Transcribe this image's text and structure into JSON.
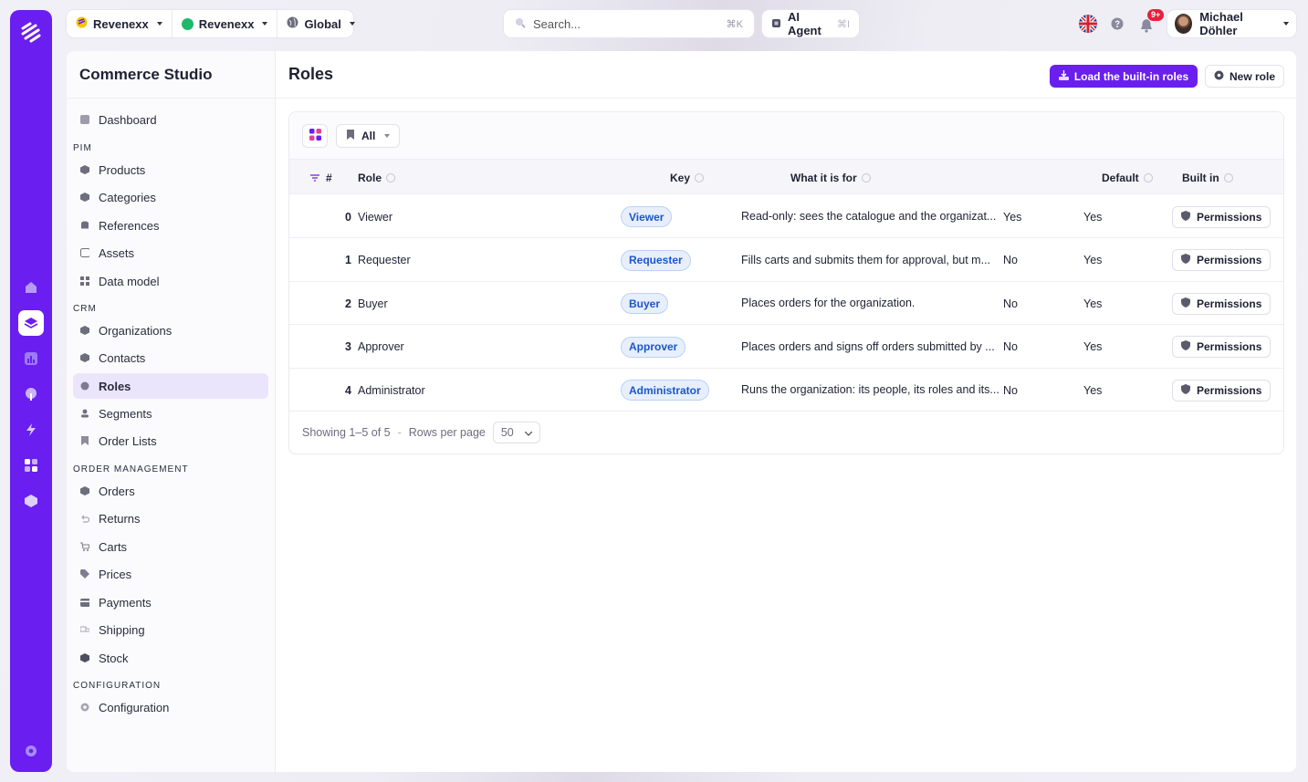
{
  "colors": {
    "accent": "#6a1ef0",
    "key_tag": "#1c56c9"
  },
  "topbar": {
    "workspace": [
      {
        "label": "Revenexx",
        "icon": "revenexx-logo-icon"
      },
      {
        "label": "Revenexx",
        "icon": "green-dot-icon"
      },
      {
        "label": "Global",
        "icon": "globe-icon"
      }
    ],
    "search": {
      "placeholder": "Search...",
      "shortcut": "⌘K"
    },
    "ai_agent": {
      "label": "AI Agent",
      "shortcut": "⌘I"
    },
    "notification_badge": "9+",
    "user": {
      "name": "Michael Döhler"
    }
  },
  "sidebar": {
    "title": "Commerce Studio",
    "sections": {
      "pim": "PIM",
      "crm": "CRM",
      "order_management": "ORDER MANAGEMENT",
      "configuration": "CONFIGURATION"
    },
    "items": {
      "dashboard": "Dashboard",
      "products": "Products",
      "categories": "Categories",
      "references": "References",
      "assets": "Assets",
      "data_model": "Data model",
      "organizations": "Organizations",
      "contacts": "Contacts",
      "roles": "Roles",
      "segments": "Segments",
      "order_lists": "Order Lists",
      "orders": "Orders",
      "returns": "Returns",
      "carts": "Carts",
      "prices": "Prices",
      "payments": "Payments",
      "shipping": "Shipping",
      "stock": "Stock",
      "configuration": "Configuration"
    }
  },
  "main": {
    "title": "Roles",
    "load_button": "Load the built-in roles",
    "new_button": "New role",
    "filter": "All",
    "columns": {
      "num": "#",
      "role": "Role",
      "key": "Key",
      "purpose": "What it is for",
      "default": "Default",
      "built_in": "Built in"
    },
    "rows": [
      {
        "num": "0",
        "role": "Viewer",
        "key": "Viewer",
        "purpose": "Read-only: sees the catalogue and the organizat...",
        "default": "Yes",
        "built_in": "Yes",
        "action": "Permissions"
      },
      {
        "num": "1",
        "role": "Requester",
        "key": "Requester",
        "purpose": "Fills carts and submits them for approval, but m...",
        "default": "No",
        "built_in": "Yes",
        "action": "Permissions"
      },
      {
        "num": "2",
        "role": "Buyer",
        "key": "Buyer",
        "purpose": "Places orders for the organization.",
        "default": "No",
        "built_in": "Yes",
        "action": "Permissions"
      },
      {
        "num": "3",
        "role": "Approver",
        "key": "Approver",
        "purpose": "Places orders and signs off orders submitted by ...",
        "default": "No",
        "built_in": "Yes",
        "action": "Permissions"
      },
      {
        "num": "4",
        "role": "Administrator",
        "key": "Administrator",
        "purpose": "Runs the organization: its people, its roles and its...",
        "default": "No",
        "built_in": "Yes",
        "action": "Permissions"
      }
    ],
    "footer": {
      "showing": "Showing 1–5 of 5",
      "separator": "-",
      "rows_label": "Rows per page",
      "rows_value": "50"
    }
  }
}
